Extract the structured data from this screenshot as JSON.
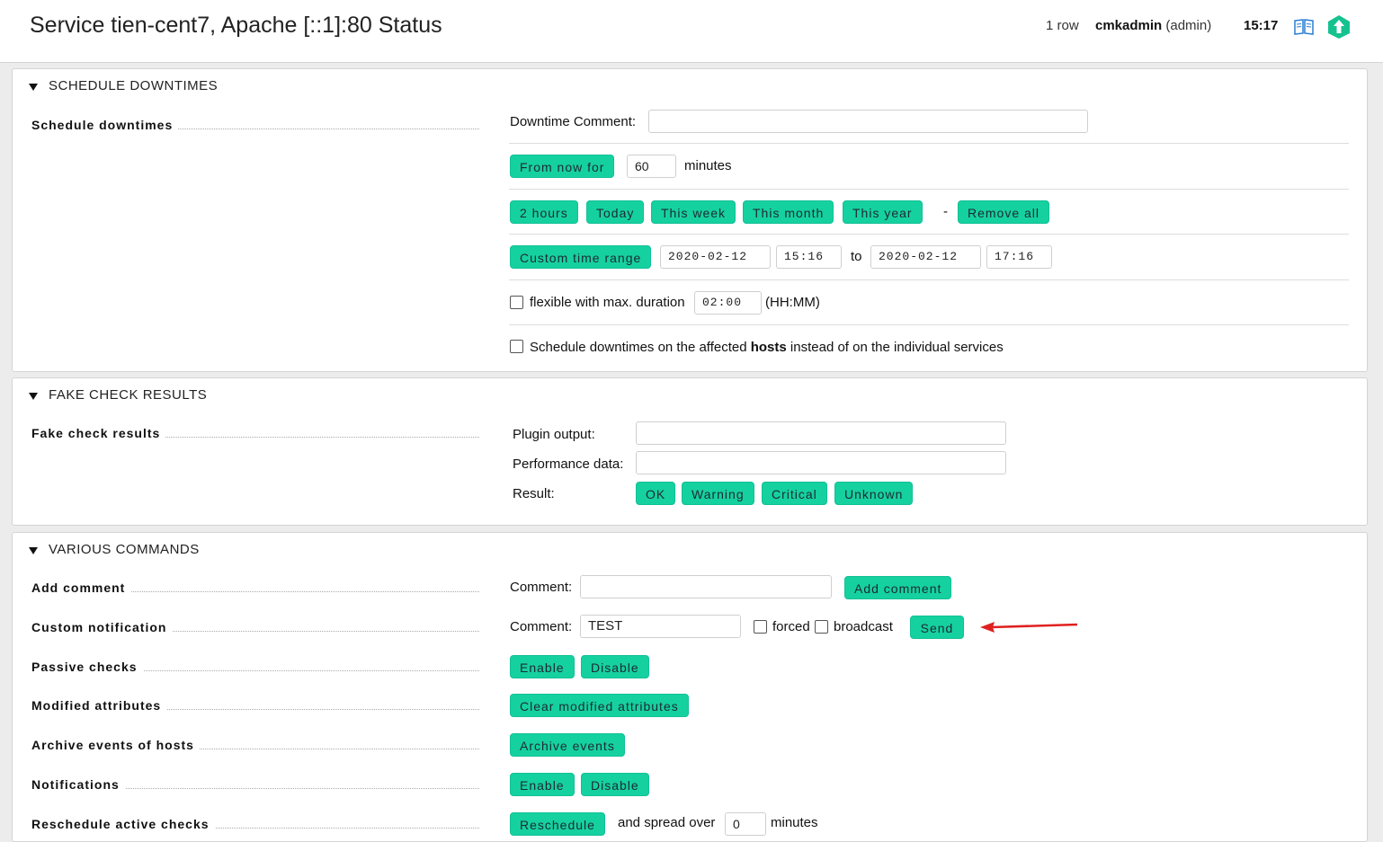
{
  "header": {
    "title": "Service tien-cent7, Apache [::1]:80 Status",
    "row_count": "1 row",
    "user_name": "cmkadmin",
    "user_role": "(admin)",
    "clock": "15:17"
  },
  "downtimes": {
    "section_title": "SCHEDULE DOWNTIMES",
    "legend": "Schedule downtimes",
    "comment_label": "Downtime Comment:",
    "comment_value": "",
    "from_now_button": "From now for",
    "minutes_value": "60",
    "minutes_label": "minutes",
    "quick_buttons": [
      "2 hours",
      "Today",
      "This week",
      "This month",
      "This year"
    ],
    "dash": "-",
    "remove_all_button": "Remove all",
    "custom_range_button": "Custom time range",
    "start_date": "2020-02-12",
    "start_time": "15:16",
    "to_label": "to",
    "end_date": "2020-02-12",
    "end_time": "17:16",
    "flexible_label": "flexible with max. duration",
    "flexible_duration": "02:00",
    "flexible_unit": "(HH:MM)",
    "hosts_label_pre": "Schedule downtimes on the affected",
    "hosts_label_bold": "hosts",
    "hosts_label_post": "instead of on the individual services"
  },
  "fake_check": {
    "section_title": "FAKE CHECK RESULTS",
    "legend": "Fake check results",
    "plugin_output_label": "Plugin output:",
    "plugin_output_value": "",
    "perf_data_label": "Performance data:",
    "perf_data_value": "",
    "result_label": "Result:",
    "result_buttons": [
      "OK",
      "Warning",
      "Critical",
      "Unknown"
    ]
  },
  "various": {
    "section_title": "VARIOUS COMMANDS",
    "add_comment_legend": "Add comment",
    "add_comment_label": "Comment:",
    "add_comment_value": "",
    "add_comment_button": "Add comment",
    "custom_notification_legend": "Custom notification",
    "notification_comment_label": "Comment:",
    "notification_comment_value": "TEST",
    "forced_label": "forced",
    "broadcast_label": "broadcast",
    "send_button": "Send",
    "passive_checks_legend": "Passive checks",
    "passive_enable": "Enable",
    "passive_disable": "Disable",
    "modified_attributes_legend": "Modified attributes",
    "clear_modified_button": "Clear modified attributes",
    "archive_events_legend": "Archive events of hosts",
    "archive_events_button": "Archive events",
    "notifications_legend": "Notifications",
    "notifications_enable": "Enable",
    "notifications_disable": "Disable",
    "reschedule_legend": "Reschedule active checks",
    "reschedule_button": "Reschedule",
    "spread_label": "and spread over",
    "spread_value": "0",
    "spread_unit": "minutes"
  },
  "colors": {
    "button": "#15d1a0",
    "annotation_arrow": "#e02020"
  }
}
